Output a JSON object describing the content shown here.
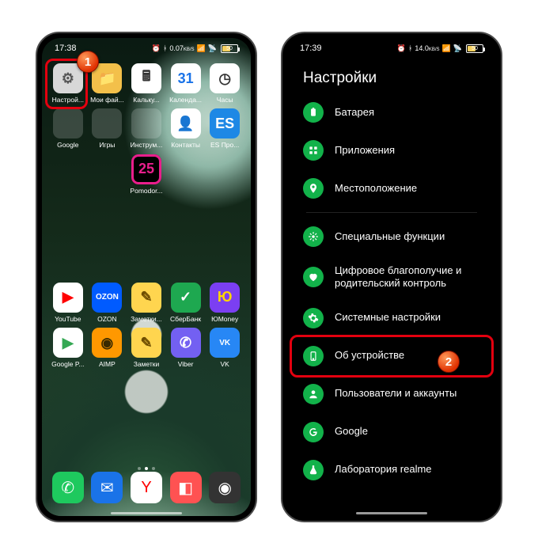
{
  "left": {
    "statusbar": {
      "time": "17:38",
      "net": "0.07",
      "netUnit": "KB/S",
      "battery": "50"
    },
    "apps_row1": [
      {
        "name": "settings",
        "label": "Настрой...",
        "glyph": "⚙",
        "bg": "#d8d8d8",
        "fg": "#555"
      },
      {
        "name": "files",
        "label": "Мои фай...",
        "glyph": "📁",
        "bg": "#f3c04a",
        "fg": "#fff"
      },
      {
        "name": "calc",
        "label": "Кальку...",
        "glyph": "🖩",
        "bg": "#ffffff",
        "fg": "#333"
      },
      {
        "name": "calendar",
        "label": "Календа...",
        "glyph": "31",
        "bg": "#ffffff",
        "fg": "#1a73e8"
      },
      {
        "name": "clock",
        "label": "Часы",
        "glyph": "◷",
        "bg": "#ffffff",
        "fg": "#333"
      }
    ],
    "apps_row2": [
      {
        "name": "folder-google",
        "label": "Google",
        "folder": true
      },
      {
        "name": "folder-games",
        "label": "Игры",
        "folder": true
      },
      {
        "name": "folder-tools",
        "label": "Инструм...",
        "folder": true
      },
      {
        "name": "contacts",
        "label": "Контакты",
        "glyph": "👤",
        "bg": "#ffffff",
        "fg": "#1a73e8"
      },
      {
        "name": "es-explorer",
        "label": "ES Про...",
        "glyph": "ES",
        "bg": "#1e88e5",
        "fg": "#fff"
      }
    ],
    "apps_row3": [
      {
        "name": "pomodoro",
        "label": "Pomodor...",
        "glyph": "25",
        "bg": "#000",
        "fg": "#e91e8c",
        "ring": true
      }
    ],
    "apps_row4": [
      {
        "name": "youtube",
        "label": "YouTube",
        "glyph": "▶",
        "bg": "#ffffff",
        "fg": "#ff0000"
      },
      {
        "name": "ozon",
        "label": "OZON",
        "glyph": "OZON",
        "bg": "#005bff",
        "fg": "#fff",
        "small": true
      },
      {
        "name": "notes",
        "label": "Заметки...",
        "glyph": "✎",
        "bg": "#ffd54f",
        "fg": "#6d4c00"
      },
      {
        "name": "sberbank",
        "label": "СберБанк",
        "glyph": "✓",
        "bg": "#1ea850",
        "fg": "#fff"
      },
      {
        "name": "yoomoney",
        "label": "ЮMoney",
        "glyph": "Ю",
        "bg": "#7b3ff2",
        "fg": "#ffd600"
      }
    ],
    "apps_row5": [
      {
        "name": "googleplay",
        "label": "Google P...",
        "glyph": "▶",
        "bg": "#ffffff",
        "fg": "#34a853"
      },
      {
        "name": "aimp",
        "label": "AIMP",
        "glyph": "◉",
        "bg": "#ff9800",
        "fg": "#3a2a00"
      },
      {
        "name": "notes2",
        "label": "Заметки",
        "glyph": "✎",
        "bg": "#ffd54f",
        "fg": "#6d4c00"
      },
      {
        "name": "viber",
        "label": "Viber",
        "glyph": "✆",
        "bg": "#7360f2",
        "fg": "#fff"
      },
      {
        "name": "vk",
        "label": "VK",
        "glyph": "VK",
        "bg": "#2787f5",
        "fg": "#fff",
        "small": true
      }
    ],
    "dock": [
      {
        "name": "phone",
        "glyph": "✆",
        "bg": "#1ec95e",
        "fg": "#fff"
      },
      {
        "name": "messages",
        "glyph": "✉",
        "bg": "#1a73e8",
        "fg": "#fff"
      },
      {
        "name": "yandex",
        "glyph": "Y",
        "bg": "#ffffff",
        "fg": "#ff0000"
      },
      {
        "name": "gallery",
        "glyph": "◧",
        "bg": "#ff5252",
        "fg": "#fff"
      },
      {
        "name": "camera",
        "glyph": "◉",
        "bg": "#333333",
        "fg": "#fff"
      }
    ]
  },
  "right": {
    "statusbar": {
      "time": "17:39",
      "net": "14.0",
      "netUnit": "KB/S",
      "battery": "50"
    },
    "title": "Настройки",
    "groups": [
      [
        {
          "name": "battery",
          "label": "Батарея",
          "icon": "battery"
        },
        {
          "name": "apps",
          "label": "Приложения",
          "icon": "grid"
        },
        {
          "name": "location",
          "label": "Местоположение",
          "icon": "pin"
        }
      ],
      [
        {
          "name": "special",
          "label": "Специальные функции",
          "icon": "star"
        },
        {
          "name": "wellbeing",
          "label": "Цифровое благополучие и родительский контроль",
          "icon": "heart"
        },
        {
          "name": "system",
          "label": "Системные настройки",
          "icon": "gear"
        },
        {
          "name": "about",
          "label": "Об устройстве",
          "icon": "phone",
          "highlight": true
        },
        {
          "name": "users",
          "label": "Пользователи и аккаунты",
          "icon": "user"
        },
        {
          "name": "google",
          "label": "Google",
          "icon": "google"
        },
        {
          "name": "realme-lab",
          "label": "Лаборатория realme",
          "icon": "flask"
        }
      ]
    ]
  },
  "callouts": {
    "one": "1",
    "two": "2"
  }
}
